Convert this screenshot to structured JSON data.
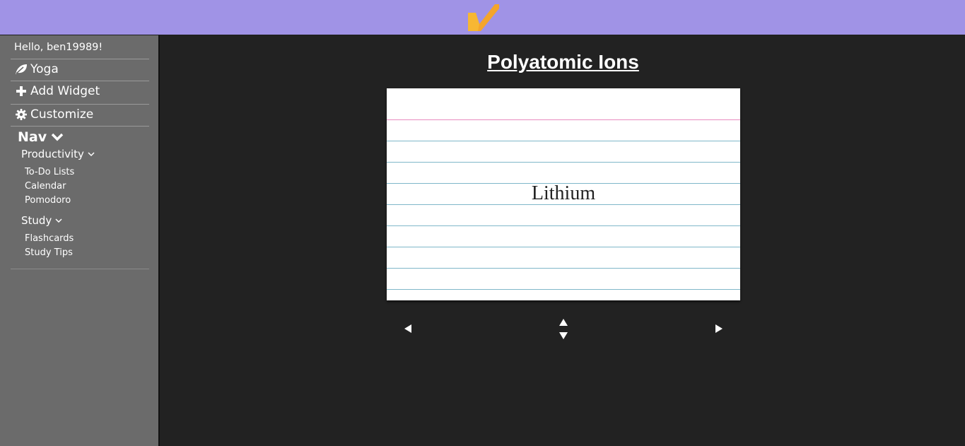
{
  "app": {
    "logo_icon": "checkmark-logo-icon",
    "accent_color": "#a093e6",
    "logo_color": "#f7b733"
  },
  "sidebar": {
    "greeting": "Hello, ben19989!",
    "items": [
      {
        "label": "Yoga",
        "icon": "leaf-icon"
      },
      {
        "label": "Add Widget",
        "icon": "plus-icon"
      },
      {
        "label": "Customize",
        "icon": "gear-icon"
      }
    ],
    "nav": {
      "title": "Nav",
      "groups": [
        {
          "title": "Productivity",
          "links": [
            "To-Do Lists",
            "Calendar",
            "Pomodoro"
          ]
        },
        {
          "title": "Study",
          "links": [
            "Flashcards",
            "Study Tips"
          ]
        }
      ]
    }
  },
  "flashcards": {
    "deck_title": "Polyatomic Ions",
    "current_card_text": "Lithium",
    "controls": {
      "prev_icon": "triangle-left-icon",
      "flip_icon": "triangle-up-down-icon",
      "next_icon": "triangle-right-icon"
    }
  }
}
